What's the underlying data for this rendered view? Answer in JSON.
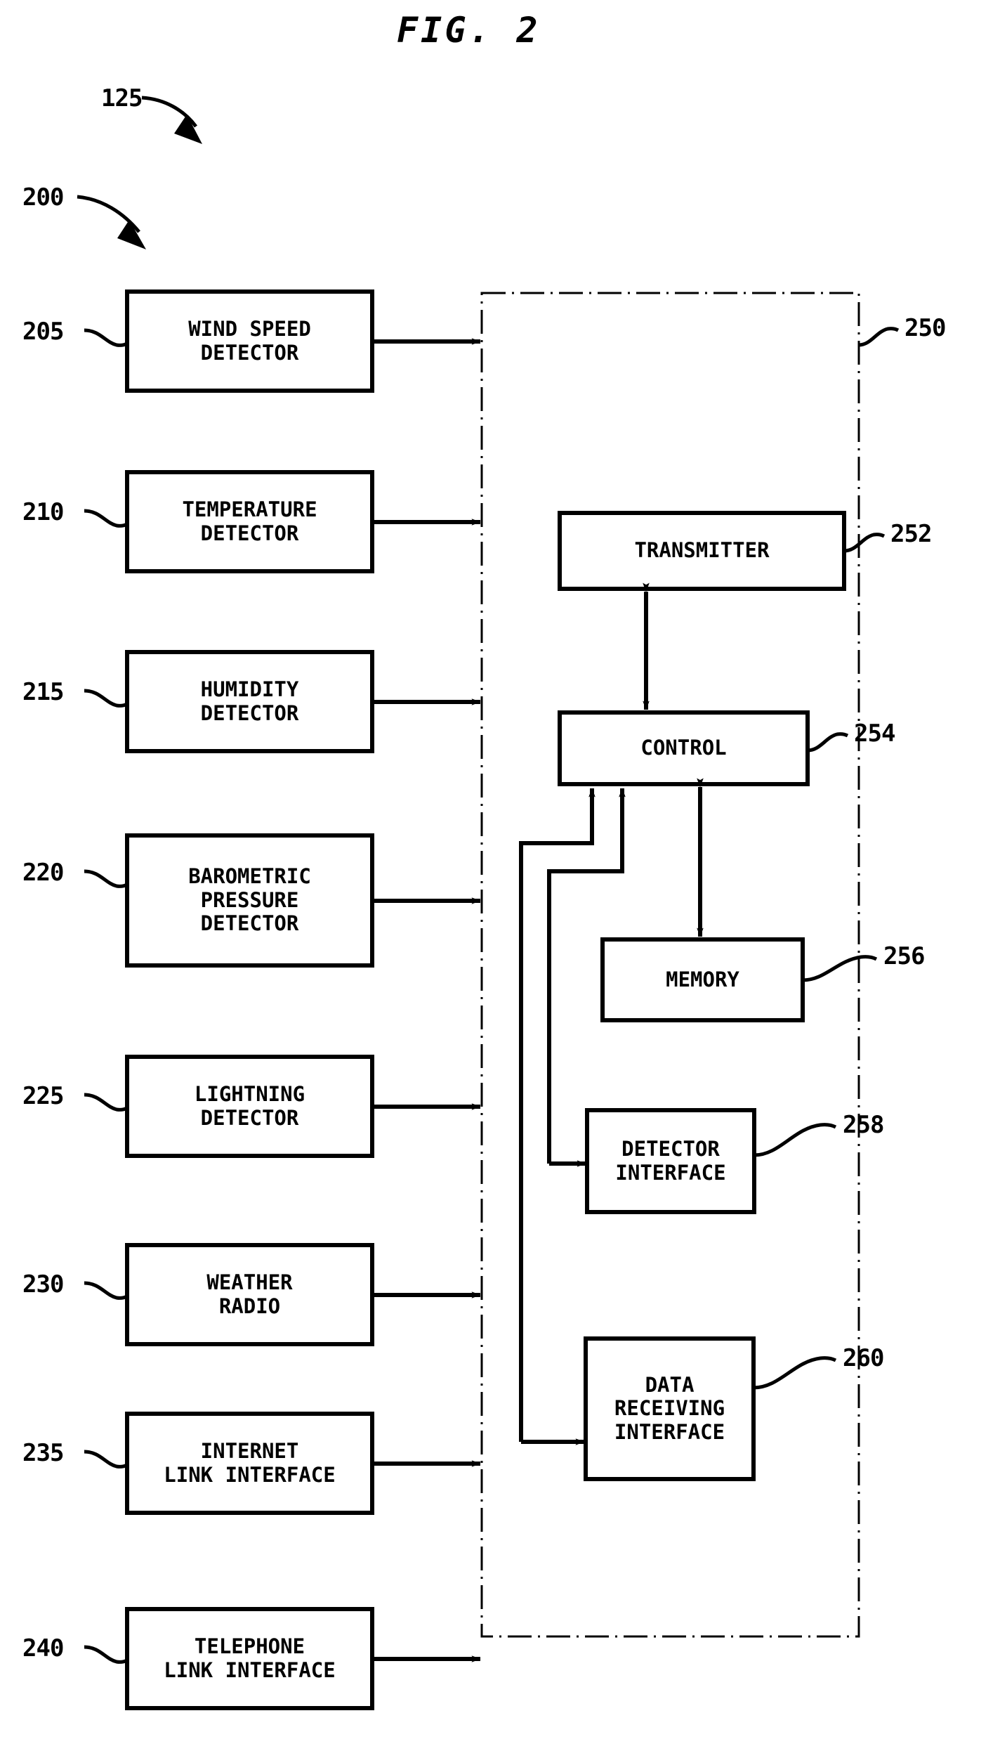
{
  "figure": {
    "title": "FIG. 2",
    "system_ref": "125",
    "assembly_ref": "200",
    "enclosure_ref": "250"
  },
  "detectors": [
    {
      "ref": "205",
      "lines": [
        "WIND SPEED",
        "DETECTOR"
      ]
    },
    {
      "ref": "210",
      "lines": [
        "TEMPERATURE",
        "DETECTOR"
      ]
    },
    {
      "ref": "215",
      "lines": [
        "HUMIDITY",
        "DETECTOR"
      ]
    },
    {
      "ref": "220",
      "lines": [
        "BAROMETRIC",
        "PRESSURE",
        "DETECTOR"
      ]
    },
    {
      "ref": "225",
      "lines": [
        "LIGHTNING",
        "DETECTOR"
      ]
    },
    {
      "ref": "230",
      "lines": [
        "WEATHER",
        "RADIO"
      ]
    },
    {
      "ref": "235",
      "lines": [
        "INTERNET",
        "LINK INTERFACE"
      ]
    },
    {
      "ref": "240",
      "lines": [
        "TELEPHONE",
        "LINK INTERFACE"
      ]
    }
  ],
  "enclosure_blocks": [
    {
      "ref": "252",
      "lines": [
        "TRANSMITTER"
      ]
    },
    {
      "ref": "254",
      "lines": [
        "CONTROL"
      ]
    },
    {
      "ref": "256",
      "lines": [
        "MEMORY"
      ]
    },
    {
      "ref": "258",
      "lines": [
        "DETECTOR",
        "INTERFACE"
      ]
    },
    {
      "ref": "260",
      "lines": [
        "DATA",
        "RECEIVING",
        "INTERFACE"
      ]
    }
  ],
  "style": {
    "ink": "#000000",
    "paper": "#ffffff"
  }
}
